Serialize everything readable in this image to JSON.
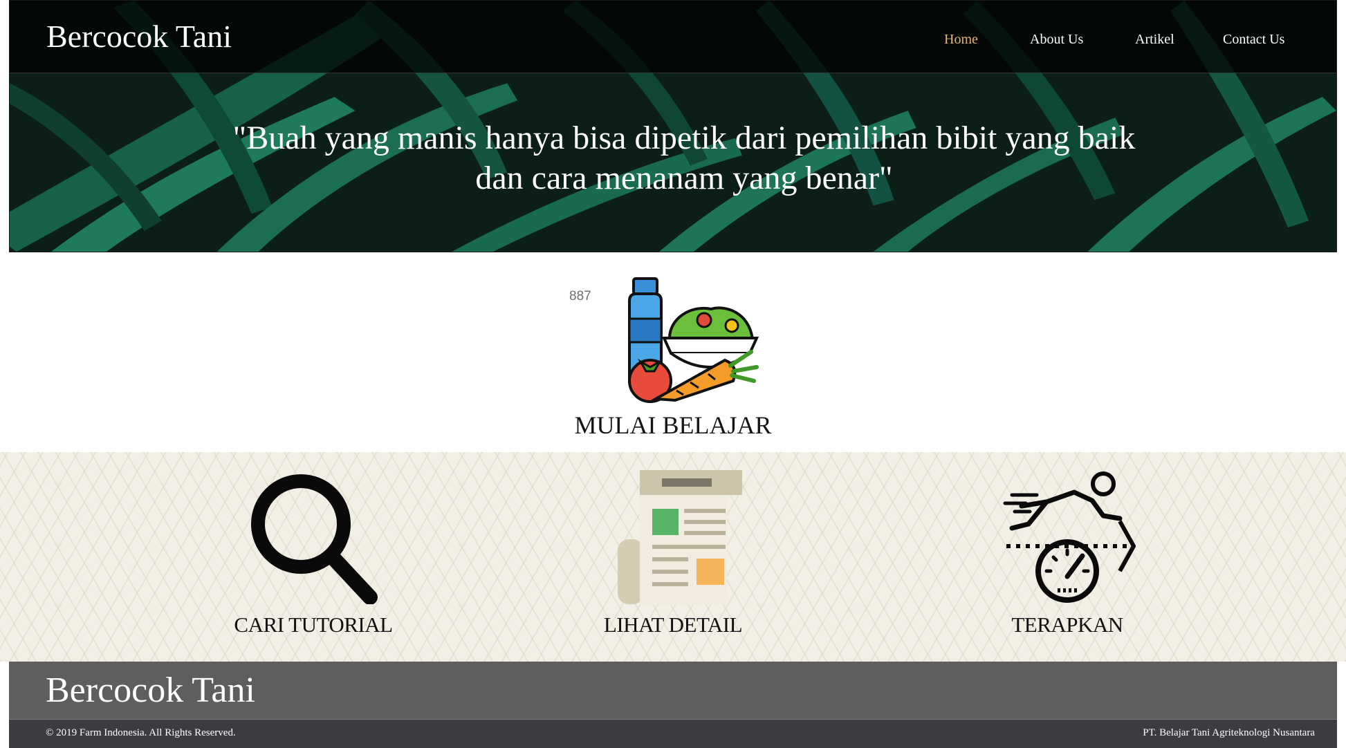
{
  "site": {
    "brand": "Bercocok Tani"
  },
  "nav": {
    "items": [
      {
        "label": "Home",
        "active": true
      },
      {
        "label": "About Us",
        "active": false
      },
      {
        "label": "Artikel",
        "active": false
      },
      {
        "label": "Contact Us",
        "active": false
      }
    ]
  },
  "hero": {
    "quote": "\"Buah yang manis hanya bisa dipetik dari pemilihan bibit yang baik dan cara menanam yang benar\""
  },
  "intro": {
    "counter": "887",
    "title": "MULAI BELAJAR",
    "icon": "healthy-food-icon"
  },
  "features": [
    {
      "label": "CARI TUTORIAL",
      "icon": "magnifier-icon"
    },
    {
      "label": "LIHAT DETAIL",
      "icon": "newspaper-icon"
    },
    {
      "label": "TERAPKAN",
      "icon": "running-speedometer-icon"
    }
  ],
  "footer": {
    "brand": "Bercocok Tani",
    "copyright": "© 2019 Farm Indonesia. All Rights Reserved.",
    "company": "PT. Belajar Tani Agriteknologi Nusantara"
  },
  "colors": {
    "nav_active": "#e8b76a",
    "footer_top": "#5e5e5e",
    "footer_bottom": "#3a3c40",
    "features_bg": "#f2efe6"
  }
}
